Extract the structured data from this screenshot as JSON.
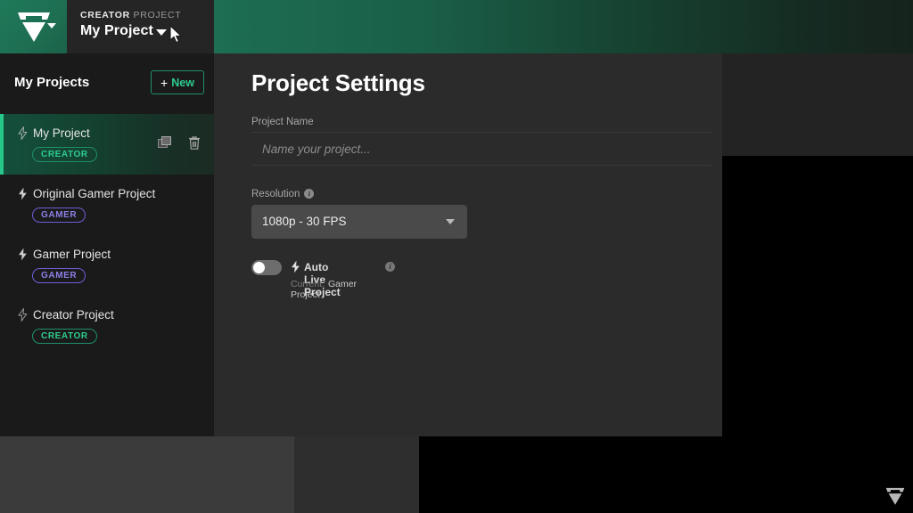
{
  "topbar": {
    "logo_name": "brand-logo",
    "eyebrow_strong": "CREATOR",
    "eyebrow_rest": "PROJECT",
    "project_title": "My Project",
    "caret": "chevron-down-icon"
  },
  "sidebar": {
    "title": "My Projects",
    "new_button": {
      "plus": "+",
      "label": "New"
    },
    "projects": [
      {
        "name": "My Project",
        "badge": "CREATOR",
        "badge_type": "creator",
        "selected": true,
        "bolt": "bolt-outline-icon"
      },
      {
        "name": "Original Gamer Project",
        "badge": "GAMER",
        "badge_type": "gamer",
        "selected": false,
        "bolt": "bolt-filled-icon"
      },
      {
        "name": "Gamer Project",
        "badge": "GAMER",
        "badge_type": "gamer",
        "selected": false,
        "bolt": "bolt-filled-icon"
      },
      {
        "name": "Creator Project",
        "badge": "CREATOR",
        "badge_type": "creator",
        "selected": false,
        "bolt": "bolt-outline-icon"
      }
    ],
    "row_actions": {
      "duplicate": "copy-icon",
      "delete": "trash-icon"
    }
  },
  "main": {
    "page_title": "Project Settings",
    "project_name": {
      "label": "Project Name",
      "value": "",
      "placeholder": "Name your project..."
    },
    "resolution": {
      "label": "Resolution",
      "info": "i",
      "value": "1080p - 30 FPS",
      "caret": "chevron-down-icon"
    },
    "auto_live": {
      "label": "Auto Live Project",
      "info": "i",
      "enabled": false,
      "current_key": "Current:",
      "current_value": "Gamer Project"
    }
  },
  "colors": {
    "brand_green": "#26c98a",
    "badge_creator": "#2ecc8f",
    "badge_gamer": "#8b7fe8",
    "header_green": "#1d6e53",
    "sidebar_bg": "#1a1a1a",
    "content_bg": "#2b2b2b"
  }
}
